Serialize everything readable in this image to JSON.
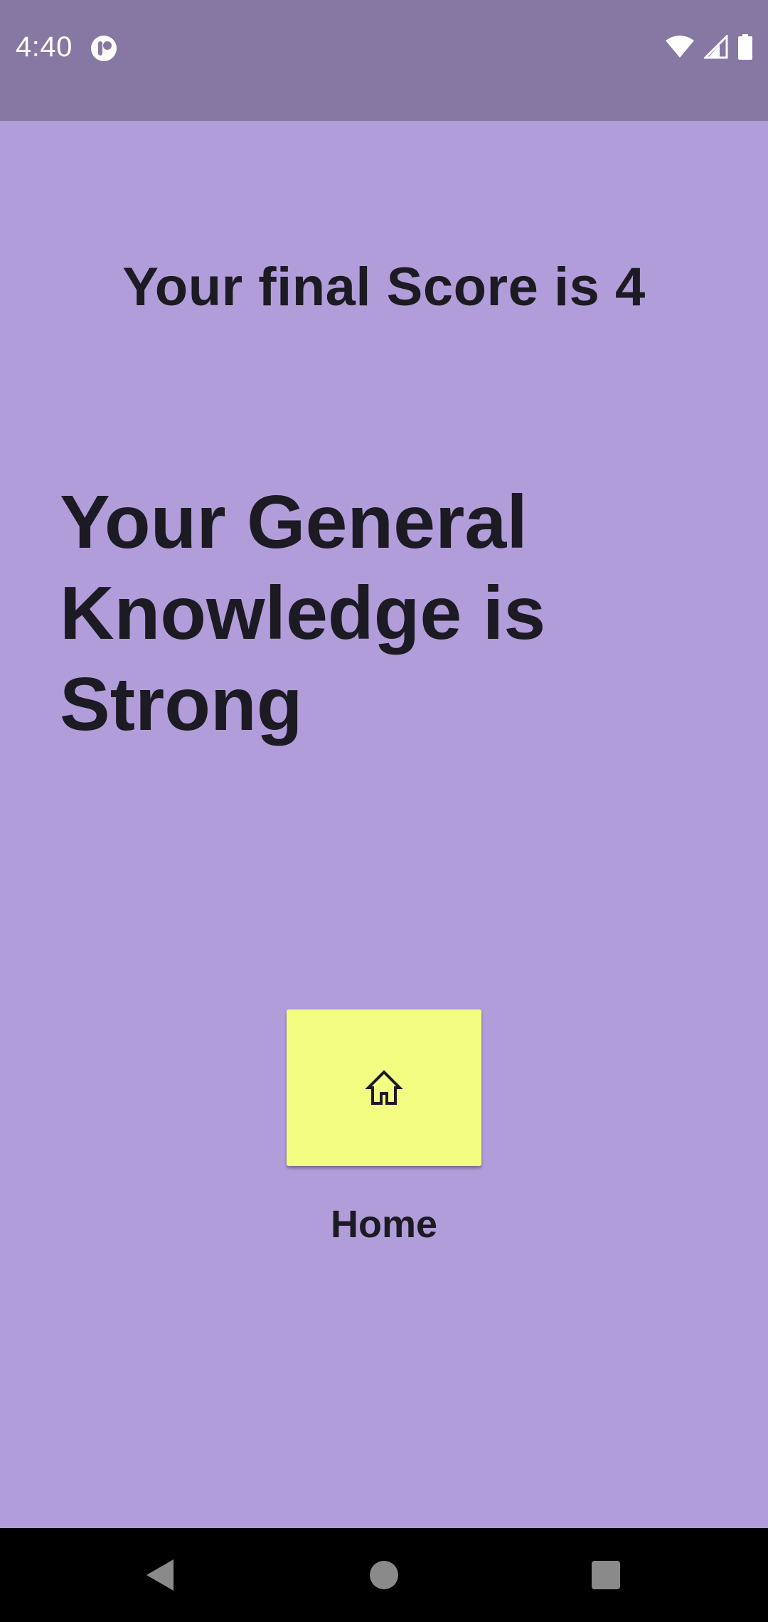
{
  "status_bar": {
    "time": "4:40",
    "icons": [
      "app-notification-icon",
      "wifi-icon",
      "signal-icon",
      "battery-icon"
    ]
  },
  "result": {
    "score_text": "Your final Score is 4",
    "verdict_text": "Your General Knowledge is Strong"
  },
  "home": {
    "icon": "home-icon",
    "label": "Home"
  },
  "nav_bar": {
    "icons": [
      "back-icon",
      "home-circle-icon",
      "recents-icon"
    ]
  },
  "colors": {
    "background": "#b29ddb",
    "status_bar": "#8778a3",
    "button": "#f3fd81",
    "text": "#1c1a22"
  }
}
